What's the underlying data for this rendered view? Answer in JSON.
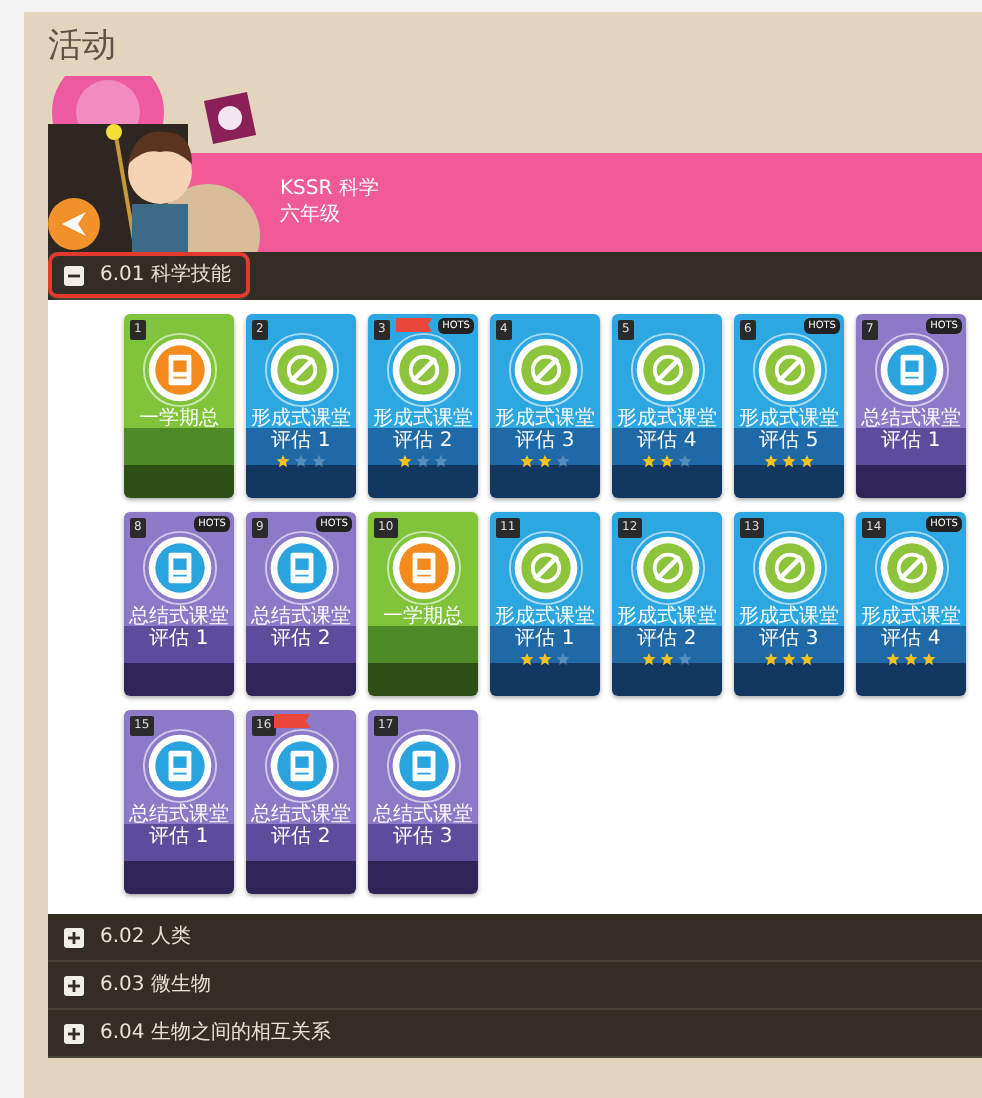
{
  "page_title": "活动",
  "banner": {
    "subject": "KSSR 科学",
    "grade": "六年级"
  },
  "sections": [
    {
      "label": "6.01 科学技能",
      "expanded": true,
      "highlighted": true,
      "cards": [
        {
          "number": "1",
          "kind": "green",
          "title": "一学期总"
        },
        {
          "number": "2",
          "kind": "blue",
          "title": "形成式课堂评估 1",
          "stars": 1
        },
        {
          "number": "3",
          "kind": "blue",
          "title": "形成式课堂评估 2",
          "stars": 1,
          "badge": "HOTS",
          "flag": true
        },
        {
          "number": "4",
          "kind": "blue",
          "title": "形成式课堂评估 3",
          "stars": 2
        },
        {
          "number": "5",
          "kind": "blue",
          "title": "形成式课堂评估 4",
          "stars": 2
        },
        {
          "number": "6",
          "kind": "blue",
          "title": "形成式课堂评估 5",
          "stars": 3,
          "badge": "HOTS"
        },
        {
          "number": "7",
          "kind": "purple",
          "title": "总结式课堂评估 1",
          "badge": "HOTS"
        },
        {
          "number": "8",
          "kind": "purple",
          "title": "总结式课堂评估 1",
          "badge": "HOTS"
        },
        {
          "number": "9",
          "kind": "purple",
          "title": "总结式课堂评估 2",
          "badge": "HOTS"
        },
        {
          "number": "10",
          "kind": "green",
          "title": "一学期总"
        },
        {
          "number": "11",
          "kind": "blue",
          "title": "形成式课堂评估 1",
          "stars": 2
        },
        {
          "number": "12",
          "kind": "blue",
          "title": "形成式课堂评估 2",
          "stars": 2
        },
        {
          "number": "13",
          "kind": "blue",
          "title": "形成式课堂评估 3",
          "stars": 3
        },
        {
          "number": "14",
          "kind": "blue",
          "title": "形成式课堂评估 4",
          "stars": 3,
          "badge": "HOTS"
        },
        {
          "number": "15",
          "kind": "purple",
          "title": "总结式课堂评估 1"
        },
        {
          "number": "16",
          "kind": "purple",
          "title": "总结式课堂评估 2",
          "flag": true
        },
        {
          "number": "17",
          "kind": "purple",
          "title": "总结式课堂评估 3"
        }
      ]
    },
    {
      "label": "6.02 人类",
      "expanded": false,
      "highlighted": false
    },
    {
      "label": "6.03 微生物",
      "expanded": false,
      "highlighted": false
    },
    {
      "label": "6.04 生物之间的相互关系",
      "expanded": false,
      "highlighted": false
    }
  ]
}
